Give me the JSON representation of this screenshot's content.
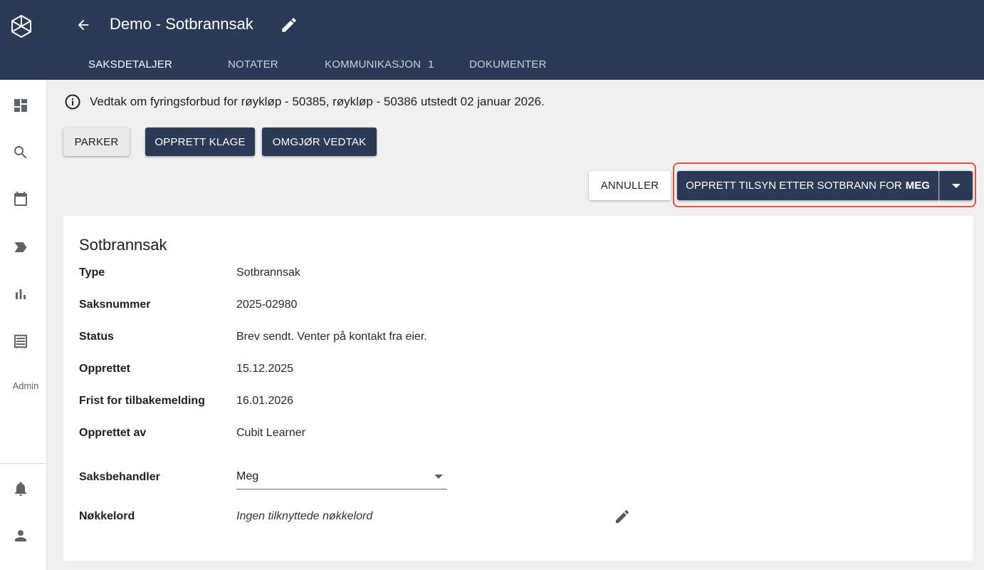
{
  "header": {
    "title": "Demo - Sotbrannsak",
    "tabs": [
      {
        "label": "SAKSDETALJER",
        "active": true
      },
      {
        "label": "NOTATER"
      },
      {
        "label": "KOMMUNIKASJON",
        "badge": "1"
      },
      {
        "label": "DOKUMENTER"
      }
    ]
  },
  "sidebar": {
    "icons": [
      "dashboard-icon",
      "search-icon",
      "calendar-icon",
      "label-icon",
      "bar-chart-icon",
      "receipt-icon"
    ],
    "admin_label": "Admin",
    "bottom_icons": [
      "bell-icon",
      "user-icon"
    ]
  },
  "notice": {
    "text": "Vedtak om fyringsforbud for røykløp - 50385, røykløp - 50386 utstedt 02 januar 2026."
  },
  "actions": {
    "parker": "PARKER",
    "opprett_klage": "OPPRETT KLAGE",
    "omgjor_vedtak": "OMGJØR VEDTAK",
    "annuller": "ANNULLER",
    "opprett_tilsyn": "OPPRETT TILSYN ETTER SOTBRANN FOR",
    "opprett_tilsyn_bold": "MEG"
  },
  "details": {
    "title": "Sotbrannsak",
    "rows": [
      {
        "label": "Type",
        "value": "Sotbrannsak"
      },
      {
        "label": "Saksnummer",
        "value": "2025-02980"
      },
      {
        "label": "Status",
        "value": "Brev sendt. Venter på kontakt fra eier."
      },
      {
        "label": "Opprettet",
        "value": "15.12.2025"
      },
      {
        "label": "Frist for tilbakemelding",
        "value": "16.01.2026"
      },
      {
        "label": "Opprettet av",
        "value": "Cubit Learner"
      }
    ],
    "saksbehandler_label": "Saksbehandler",
    "saksbehandler_value": "Meg",
    "nokkelord_label": "Nøkkelord",
    "nokkelord_value": "Ingen tilknyttede nøkkelord"
  },
  "colors": {
    "primary": "#2b3a55",
    "highlight": "#e0513c",
    "background": "#f0f0f0"
  }
}
